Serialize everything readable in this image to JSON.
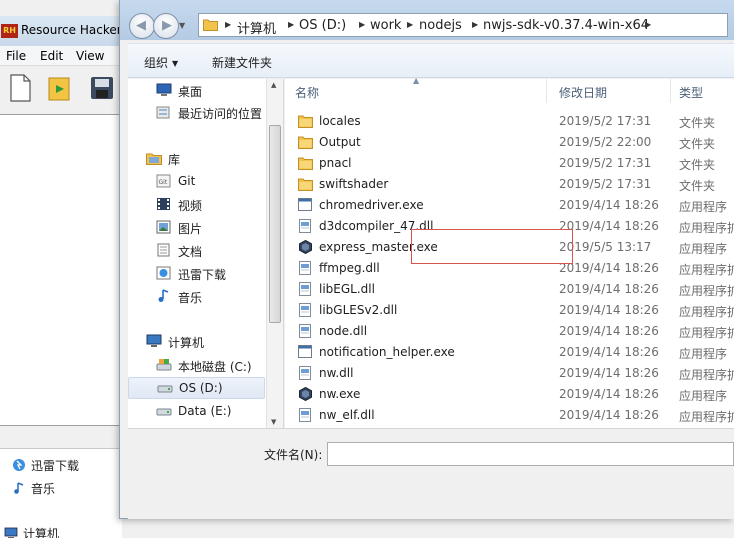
{
  "background_app": {
    "title": "Resource Hacker",
    "menu": [
      "File",
      "Edit",
      "View"
    ],
    "tree_items": [
      {
        "label": "迅雷下载",
        "icon": "thunder-download-icon"
      },
      {
        "label": "音乐",
        "icon": "music-note-icon"
      },
      {
        "label": "计算机",
        "icon": "computer-icon"
      }
    ]
  },
  "dialog": {
    "breadcrumbs": [
      "计算机",
      "OS (D:)",
      "work",
      "nodejs",
      "nwjs-sdk-v0.37.4-win-x64"
    ],
    "toolbar": {
      "organize_label": "组织",
      "new_folder_label": "新建文件夹"
    },
    "nav_pane": {
      "favorites": [
        {
          "label": "桌面",
          "icon": "desktop-icon"
        },
        {
          "label": "最近访问的位置",
          "icon": "recent-places-icon"
        }
      ],
      "libraries_header": "库",
      "libraries": [
        {
          "label": "Git",
          "icon": "git-library-icon"
        },
        {
          "label": "视频",
          "icon": "video-library-icon"
        },
        {
          "label": "图片",
          "icon": "pictures-library-icon"
        },
        {
          "label": "文档",
          "icon": "documents-library-icon"
        },
        {
          "label": "迅雷下载",
          "icon": "thunder-download-icon"
        },
        {
          "label": "音乐",
          "icon": "music-note-icon"
        }
      ],
      "computer_header": "计算机",
      "drives": [
        {
          "label": "本地磁盘 (C:)",
          "icon": "system-drive-icon"
        },
        {
          "label": "OS (D:)",
          "icon": "drive-icon"
        },
        {
          "label": "Data (E:)",
          "icon": "drive-icon"
        }
      ]
    },
    "columns": {
      "name": "名称",
      "date": "修改日期",
      "type": "类型"
    },
    "files": [
      {
        "name": "locales",
        "date": "2019/5/2 17:31",
        "type": "文件夹",
        "kind": "folder"
      },
      {
        "name": "Output",
        "date": "2019/5/2 22:00",
        "type": "文件夹",
        "kind": "folder"
      },
      {
        "name": "pnacl",
        "date": "2019/5/2 17:31",
        "type": "文件夹",
        "kind": "folder"
      },
      {
        "name": "swiftshader",
        "date": "2019/5/2 17:31",
        "type": "文件夹",
        "kind": "folder"
      },
      {
        "name": "chromedriver.exe",
        "date": "2019/4/14 18:26",
        "type": "应用程序",
        "kind": "exe"
      },
      {
        "name": "d3dcompiler_47.dll",
        "date": "2019/4/14 18:26",
        "type": "应用程序扩",
        "kind": "dll"
      },
      {
        "name": "express_master.exe",
        "date": "2019/5/5 13:17",
        "type": "应用程序",
        "kind": "app"
      },
      {
        "name": "ffmpeg.dll",
        "date": "2019/4/14 18:26",
        "type": "应用程序扩",
        "kind": "dll"
      },
      {
        "name": "libEGL.dll",
        "date": "2019/4/14 18:26",
        "type": "应用程序扩",
        "kind": "dll"
      },
      {
        "name": "libGLESv2.dll",
        "date": "2019/4/14 18:26",
        "type": "应用程序扩",
        "kind": "dll"
      },
      {
        "name": "node.dll",
        "date": "2019/4/14 18:26",
        "type": "应用程序扩",
        "kind": "dll"
      },
      {
        "name": "notification_helper.exe",
        "date": "2019/4/14 18:26",
        "type": "应用程序",
        "kind": "exe"
      },
      {
        "name": "nw.dll",
        "date": "2019/4/14 18:26",
        "type": "应用程序扩",
        "kind": "dll"
      },
      {
        "name": "nw.exe",
        "date": "2019/4/14 18:26",
        "type": "应用程序",
        "kind": "app"
      },
      {
        "name": "nw_elf.dll",
        "date": "2019/4/14 18:26",
        "type": "应用程序扩",
        "kind": "dll"
      }
    ],
    "filename_label": "文件名(N):",
    "filename_value": ""
  },
  "colors": {
    "highlight_box": "#d9534f",
    "selected_nav_bg": "#dfe8f4",
    "column_header_text": "#4c607a"
  }
}
